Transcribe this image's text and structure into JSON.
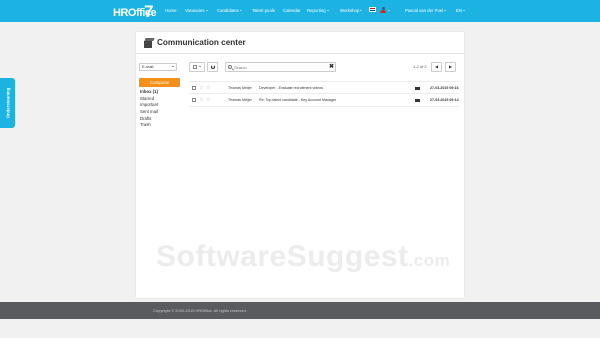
{
  "brand": {
    "logo_text": "HROffice",
    "logo_number": "7"
  },
  "colors": {
    "primary": "#1cb3e2",
    "accent": "#f39019",
    "footer": "#5a5b5f"
  },
  "nav": {
    "home": "Home",
    "vacancies": "Vacancies",
    "candidates": "Candidates",
    "talent_pools": "Talent pools",
    "calendar": "Calendar",
    "reporting": "Reporting",
    "workshop": "Workshop",
    "user": "Pascal van der Poel",
    "language": "EN"
  },
  "side_tab": {
    "label": "Ondersteuning"
  },
  "page": {
    "title": "Communication center"
  },
  "toolbar": {
    "mailbox_select": "E-mail",
    "refresh_label": "",
    "search_placeholder": "Search",
    "clear_label": "✖",
    "pagination": "1-2 of 2",
    "prev_label": "◀",
    "next_label": "▶"
  },
  "sidebar": {
    "compose_label": "Compose",
    "folders": [
      {
        "label": "Inbox (1)",
        "active": true
      },
      {
        "label": "Starred"
      },
      {
        "label": "Important"
      },
      {
        "label": "Sent mail"
      },
      {
        "label": "Drafts"
      },
      {
        "label": "Trash"
      }
    ]
  },
  "mails": [
    {
      "sender": "Thomas Meijer",
      "subject": "Developer - Evaluate recruitment videos",
      "date": "27-03-2015 09:16"
    },
    {
      "sender": "Thomas Meijer",
      "subject": "Re: Top talent candidate - Key Account Manager",
      "date": "27-03-2015 09:14"
    }
  ],
  "watermark": {
    "text": "SoftwareSuggest",
    "suffix": ".com"
  },
  "footer": {
    "copyright": "Copyright © 2000-2015 HROffice. All rights reserved."
  }
}
